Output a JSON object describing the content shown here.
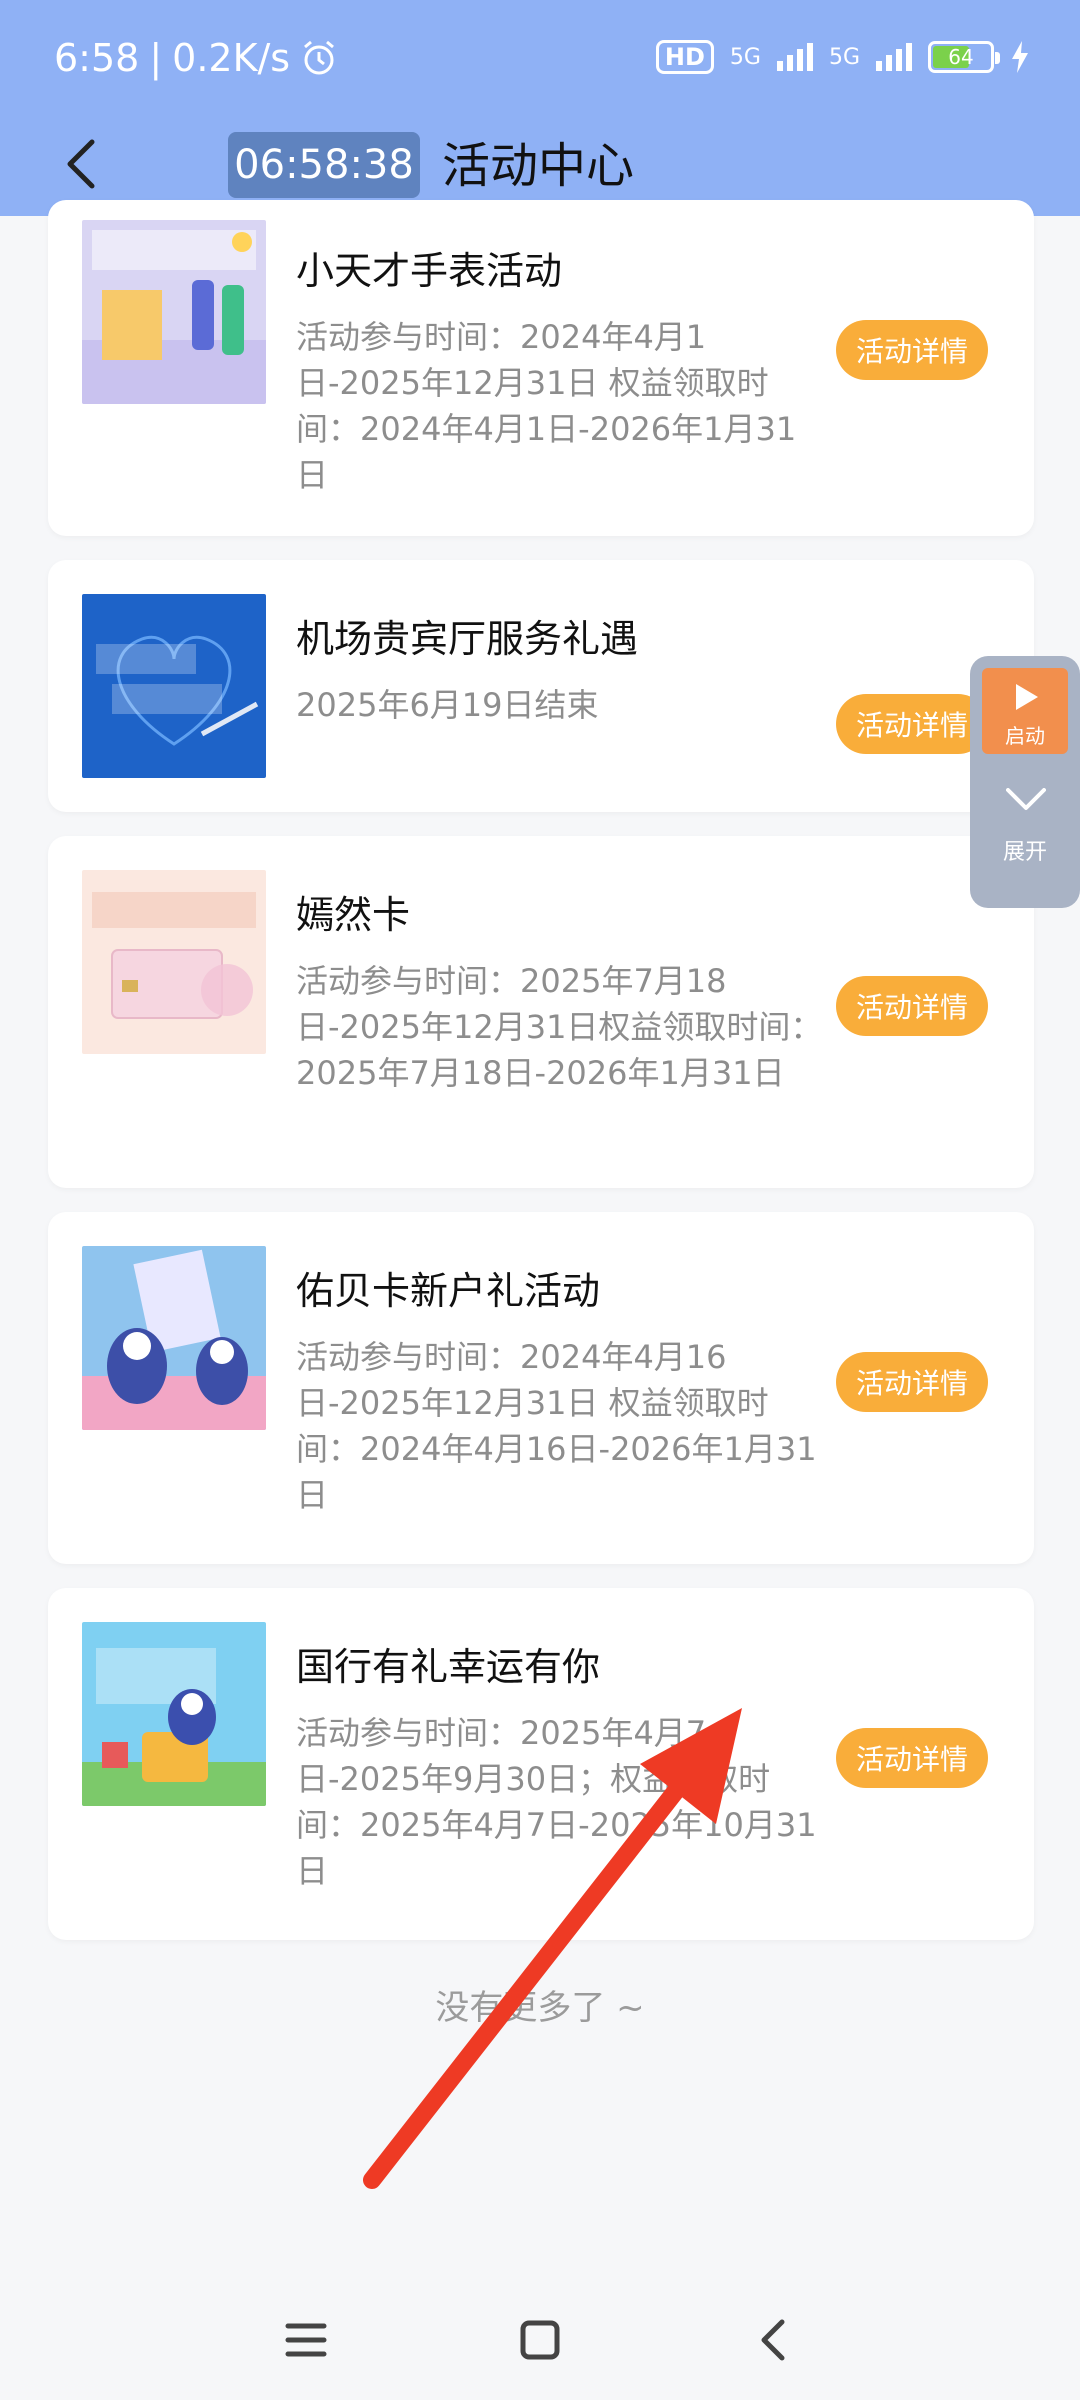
{
  "status": {
    "time": "6:58",
    "speed": "0.2K/s",
    "network1": "5G",
    "network2": "5G",
    "hd_badge": "HD",
    "battery": "64"
  },
  "nav": {
    "clock": "06:58:38",
    "title": "活动中心"
  },
  "activities": [
    {
      "title": "小天才手表活动",
      "desc": "活动参与时间：2024年4月1日-2025年12月31日 权益领取时间：2024年4月1日-2026年1月31日",
      "button": "活动详情"
    },
    {
      "title": "机场贵宾厅服务礼遇",
      "desc": "2025年6月19日结束",
      "button": "活动详情"
    },
    {
      "title": "嫣然卡",
      "desc": "活动参与时间：2025年7月18日-2025年12月31日权益领取时间：2025年7月18日-2026年1月31日",
      "button": "活动详情"
    },
    {
      "title": "佑贝卡新户礼活动",
      "desc": "活动参与时间：2024年4月16日-2025年12月31日 权益领取时间：2024年4月16日-2026年1月31日",
      "button": "活动详情"
    },
    {
      "title": "国行有礼幸运有你",
      "desc": "活动参与时间：2025年4月7日-2025年9月30日；权益领取时间：2025年4月7日-2025年10月31日",
      "button": "活动详情"
    }
  ],
  "footer": {
    "no_more": "没有更多了 ~"
  },
  "float_panel": {
    "start_label": "启动",
    "expand_label": "展开"
  }
}
